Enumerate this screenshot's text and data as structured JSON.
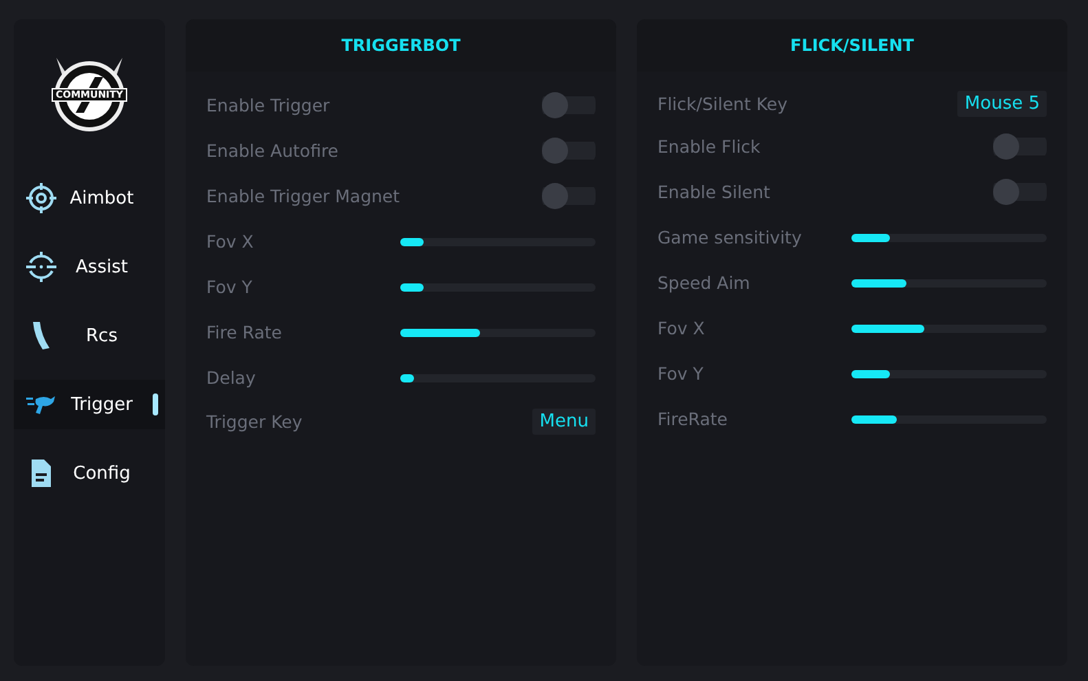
{
  "logo": {
    "text": "COMMUNITY"
  },
  "sidebar": {
    "items": [
      {
        "label": "Aimbot",
        "selected": false
      },
      {
        "label": "Assist",
        "selected": false
      },
      {
        "label": "Rcs",
        "selected": false
      },
      {
        "label": "Trigger",
        "selected": true
      },
      {
        "label": "Config",
        "selected": false
      }
    ]
  },
  "panels": [
    {
      "title": "TRIGGERBOT",
      "rows": [
        {
          "kind": "toggle",
          "label": "Enable Trigger",
          "on": false
        },
        {
          "kind": "toggle",
          "label": "Enable Autofire",
          "on": false
        },
        {
          "kind": "toggle",
          "label": "Enable Trigger Magnet",
          "on": false
        },
        {
          "kind": "slider",
          "label": "Fov X",
          "level": 0.12
        },
        {
          "kind": "slider",
          "label": "Fov Y",
          "level": 0.12
        },
        {
          "kind": "slider",
          "label": "Fire Rate",
          "level": 0.41
        },
        {
          "kind": "slider",
          "label": "Delay",
          "level": 0.07
        },
        {
          "kind": "key",
          "label": "Trigger Key",
          "value": "Menu"
        }
      ]
    },
    {
      "title": "FLICK/SILENT",
      "rows": [
        {
          "kind": "key",
          "label": "Flick/Silent Key",
          "value": "Mouse 5"
        },
        {
          "kind": "toggle",
          "label": "Enable Flick",
          "on": false
        },
        {
          "kind": "toggle",
          "label": "Enable Silent",
          "on": false
        },
        {
          "kind": "slider",
          "label": "Game sensitivity",
          "level": 0.2
        },
        {
          "kind": "slider",
          "label": "Speed Aim",
          "level": 0.28
        },
        {
          "kind": "slider",
          "label": "Fov X",
          "level": 0.37
        },
        {
          "kind": "slider",
          "label": "Fov Y",
          "level": 0.2
        },
        {
          "kind": "slider",
          "label": "FireRate",
          "level": 0.23
        }
      ]
    }
  ]
}
